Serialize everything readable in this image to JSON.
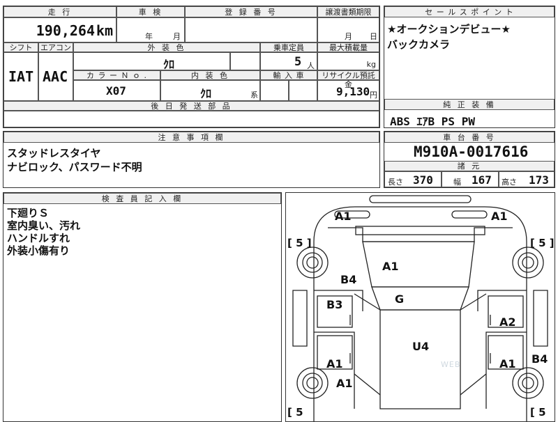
{
  "mileage": {
    "header": "走 行",
    "value": "190,264",
    "unit": "km"
  },
  "shaken": {
    "header": "車 検",
    "year_label": "年",
    "month_label": "月"
  },
  "registration": {
    "header": "登 録 番 号"
  },
  "transfer": {
    "header": "譲渡書類期限",
    "month_label": "月",
    "day_label": "日"
  },
  "shift": {
    "header": "シフト",
    "value": "IAT"
  },
  "aircon": {
    "header": "エアコン",
    "value": "AAC"
  },
  "exterior_color": {
    "header": "外 装 色",
    "value": "ｸﾛ"
  },
  "capacity": {
    "header": "乗車定員",
    "value": "5",
    "unit": "人"
  },
  "max_load": {
    "header": "最大積載量",
    "unit": "kg"
  },
  "color_no": {
    "header": "カ ラ ー Ｎ ｏ .",
    "value": "X07"
  },
  "interior_color": {
    "header": "内 装 色",
    "value": "ｸﾛ",
    "suffix": "系"
  },
  "import": {
    "header": "輸 入 車"
  },
  "recycle": {
    "header": "リサイクル預託金",
    "value": "9,130",
    "unit": "円"
  },
  "later_parts": {
    "header": "後 日 発 送 部 品"
  },
  "sales_point": {
    "header": "セ ー ル ス ポ イ ン ト",
    "lines": [
      "★オークションデビュー★",
      "バックカメラ"
    ]
  },
  "equipment": {
    "header": "純 正 装 備",
    "value": "ABS ｴｱB PS PW"
  },
  "caution": {
    "header": "注 意 事 項 欄",
    "lines": [
      "スタッドレスタイヤ",
      "ナビロック、パスワード不明"
    ]
  },
  "chassis": {
    "header": "車 台 番 号",
    "value": "M910A-0017616"
  },
  "specs": {
    "header": "諸 元",
    "length_label": "長さ",
    "length": "370",
    "width_label": "幅",
    "width": "167",
    "height_label": "高さ",
    "height": "173"
  },
  "inspector": {
    "header": "検 査 員 記 入 欄",
    "lines": [
      "下廻りＳ",
      "室内臭い、汚れ",
      "ハンドルすれ",
      "外装小傷有り"
    ]
  },
  "diagram": {
    "tire_fl": "[ 5 ]",
    "tire_fr": "[ 5 ]",
    "tire_rl": "[ 5",
    "tire_rr": "[ 5",
    "a1_tl": "A1",
    "a1_tr": "A1",
    "hood_a1": "A1",
    "b4_left": "B4",
    "glass_g": "G",
    "b3_left": "B3",
    "a2_right": "A2",
    "roof_u4": "U4",
    "a1_ldoor": "A1",
    "a1_rdoor": "A1",
    "b4_right": "B4",
    "a1_lrear": "A1",
    "watermark": "WEB"
  }
}
